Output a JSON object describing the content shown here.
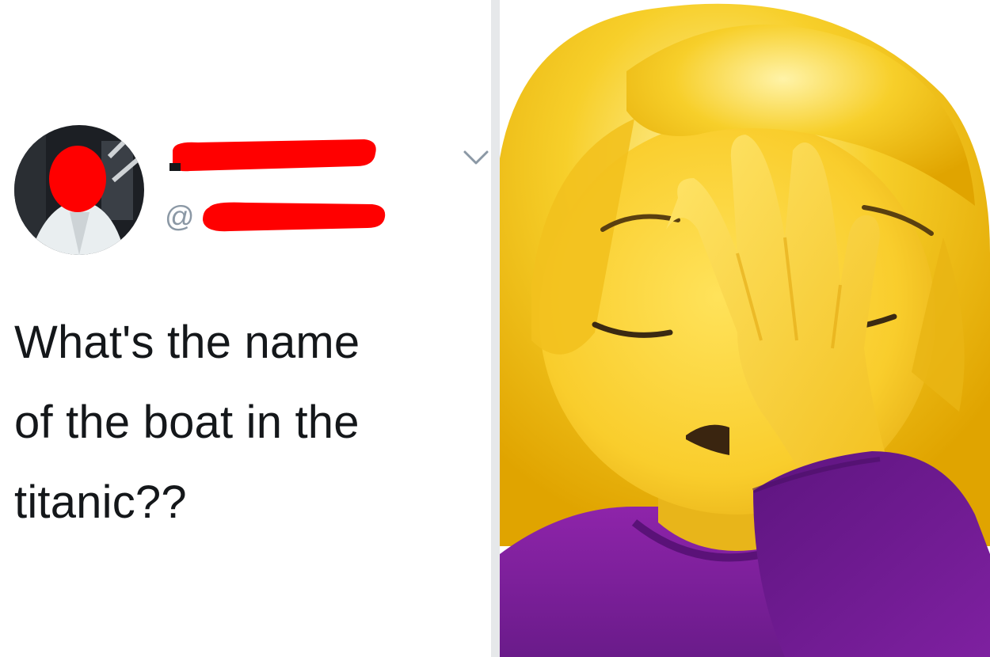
{
  "tweet": {
    "handle_prefix": "@",
    "text_lines": [
      "What's the name",
      "of the boat in the",
      "titanic??"
    ]
  },
  "icons": {
    "menu": "chevron-down-icon",
    "emoji": "woman-facepalming-emoji"
  },
  "colors": {
    "redaction": "#ff0000",
    "text": "#14171a",
    "handle": "#8b98a5",
    "hair": "#f5c518",
    "skin": "#f9d23a",
    "sleeve": "#7b1fa2"
  }
}
